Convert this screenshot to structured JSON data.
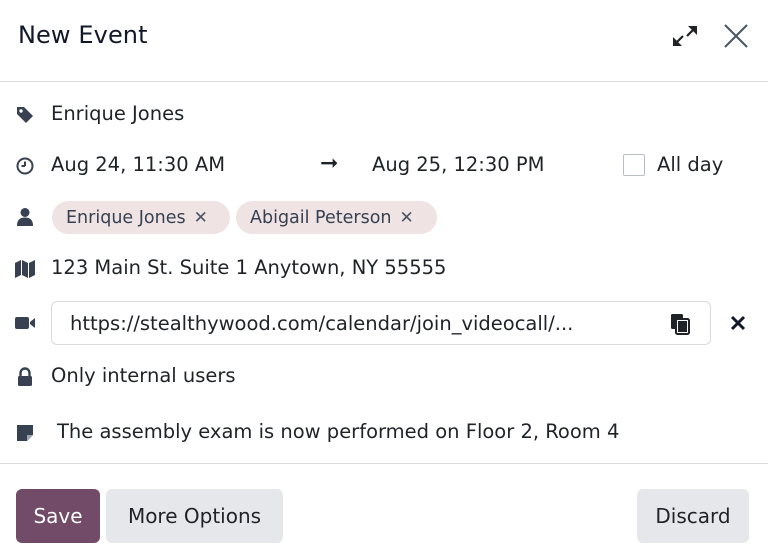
{
  "dialog": {
    "title": "New Event"
  },
  "event": {
    "name": "Enrique Jones",
    "start": "Aug 24, 11:30 AM",
    "arrow": "➞",
    "end": "Aug 25, 12:30 PM",
    "all_day_label": "All day",
    "all_day_checked": false,
    "attendees": [
      {
        "name": "Enrique Jones",
        "remove": "✕"
      },
      {
        "name": "Abigail Peterson",
        "remove": "✕"
      }
    ],
    "location": "123 Main St. Suite 1 Anytown, NY 55555",
    "videocall_url": "https://stealthywood.com/calendar/join_videocall/...",
    "privacy": "Only internal users",
    "description": "The assembly exam is now performed on Floor 2, Room 4"
  },
  "footer": {
    "save_label": "Save",
    "more_options_label": "More Options",
    "discard_label": "Discard"
  },
  "icons": {
    "tag": "tag-icon",
    "clock": "clock-icon",
    "user": "user-icon",
    "map": "map-icon",
    "video": "video-camera-icon",
    "lock": "lock-icon",
    "note": "sticky-note-icon",
    "copy": "copy-icon",
    "expand": "expand-icon",
    "close": "close-icon",
    "clear": "clear-icon"
  },
  "colors": {
    "primary": "#714b67",
    "tag_background": "#efe3e4",
    "secondary_button": "#e6e7ea",
    "icon": "#374151"
  }
}
